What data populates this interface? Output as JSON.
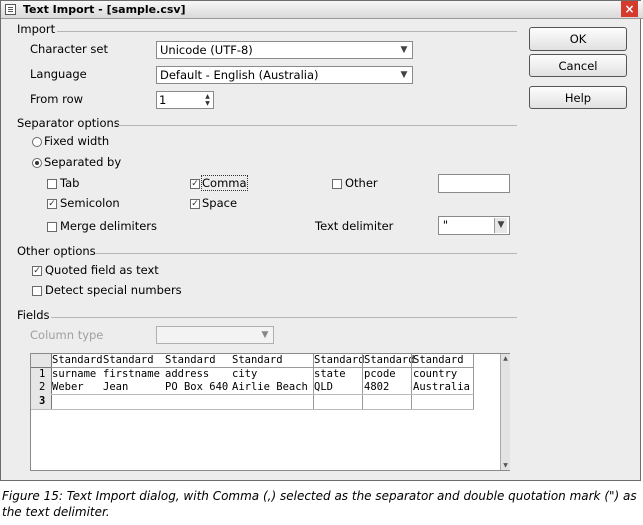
{
  "window": {
    "title": "Text Import - [sample.csv]",
    "close_glyph": "×"
  },
  "import": {
    "heading": "Import",
    "charset_label": "Character set",
    "charset_value": "Unicode (UTF-8)",
    "language_label": "Language",
    "language_value": "Default - English (Australia)",
    "fromrow_label": "From row",
    "fromrow_value": "1"
  },
  "buttons": {
    "ok": "OK",
    "cancel": "Cancel",
    "help": "Help"
  },
  "separator": {
    "heading": "Separator options",
    "fixed_width": "Fixed width",
    "separated_by": "Separated by",
    "mode": "separated_by",
    "tab": "Tab",
    "tab_checked": false,
    "comma": "Comma",
    "comma_checked": true,
    "other": "Other",
    "other_checked": false,
    "other_value": "",
    "semicolon": "Semicolon",
    "semicolon_checked": true,
    "space": "Space",
    "space_checked": true,
    "merge": "Merge delimiters",
    "merge_checked": false,
    "text_delim_label": "Text delimiter",
    "text_delim_value": "\""
  },
  "other_options": {
    "heading": "Other options",
    "quoted": "Quoted field as text",
    "quoted_checked": true,
    "detect": "Detect special numbers",
    "detect_checked": false
  },
  "fields": {
    "heading": "Fields",
    "column_type_label": "Column type",
    "column_type_value": "",
    "columns": [
      "Standard",
      "Standard",
      "Standard",
      "Standard",
      "Standard",
      "Standard",
      "Standard"
    ],
    "row_numbers": [
      "1",
      "2",
      "3"
    ],
    "rows": [
      [
        "surname",
        "firstname",
        "address",
        "city",
        "state",
        "pcode",
        "country"
      ],
      [
        "Weber",
        "Jean",
        "PO Box 640",
        "Airlie Beach",
        "QLD",
        "4802",
        "Australia"
      ]
    ]
  },
  "caption": "Figure 15: Text Import dialog, with Comma (,) selected as the separator and double quotation mark (\") as the text delimiter.",
  "colors": {
    "dialog_bg": "#ededed",
    "close_red": "#d63a2f"
  }
}
